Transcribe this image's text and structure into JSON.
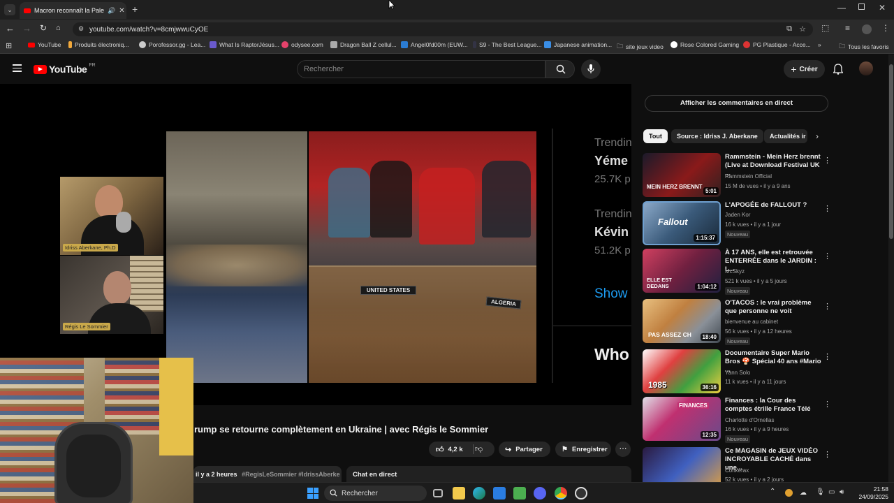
{
  "browser": {
    "tab_title": "Macron reconnaît la Palesti",
    "url": "youtube.com/watch?v=8cmjwwuCyOE",
    "bookmarks": [
      "YouTube",
      "Produits électroniq...",
      "Porofessor.gg - Lea...",
      "What Is RaptorJésus...",
      "odysee.com",
      "Dragon Ball Z cellul...",
      "Angel0fd00m (EUW...",
      "S9 - The Best League...",
      "Japanese animation...",
      "site jeux video",
      "Rose Colored Gaming",
      "PG Plastique - Acce..."
    ],
    "all_bookmarks": "Tous les favoris"
  },
  "youtube": {
    "logo": "YouTube",
    "country": "FR",
    "search_placeholder": "Rechercher",
    "create_label": "Créer"
  },
  "video": {
    "title": "rump se retourne complètement en Ukraine | avec Régis le Sommier",
    "likes": "4,2 k",
    "share_label": "Partager",
    "save_label": "Enregistrer",
    "date": "il y a 2 heures",
    "hashtags": "#RegisLeSommier #IdrissAberke",
    "live_chat_label": "Chat en direct",
    "guest1": "Idriss Aberkane, Ph.D",
    "guest2": "Régis Le Sommier",
    "placard_us": "UNITED STATES",
    "placard_algeria": "ALGERIA",
    "overlay": [
      {
        "label": "Trendin",
        "name": "Yéme",
        "count": "25.7K p"
      },
      {
        "label": "Trendin",
        "name": "Kévin",
        "count": "51.2K p"
      }
    ],
    "show_label": "Show",
    "who_label": "Who"
  },
  "sidebar": {
    "live_comments_btn": "Afficher les commentaires en direct",
    "chips": [
      "Tout",
      "Source : Idriss J. Aberkane",
      "Actualités ir"
    ],
    "videos": [
      {
        "title": "Rammstein - Mein Herz brennt (Live at Download Festival UK ...",
        "channel": "Rammstein Official",
        "meta": "15 M de vues • il y a 9 ans",
        "duration": "5:01",
        "thumb_text": "MEIN HERZ BRENNT",
        "new": ""
      },
      {
        "title": "L'APOGÉE de FALLOUT ?",
        "channel": "Jaden Kor",
        "meta": "16 k vues • il y a 1 jour",
        "duration": "1:15:37",
        "thumb_text": "Fallout",
        "new": "Nouveau"
      },
      {
        "title": "À 17 ANS, elle est retrouvée ENTERRÉE dans le JARDIN : L...",
        "channel": "McSkyz",
        "meta": "521 k vues • il y a 5 jours",
        "duration": "1:04:12",
        "thumb_text": "ELLE EST DEDANS",
        "new": "Nouveau"
      },
      {
        "title": "O'TACOS : le vrai problème que personne ne voit",
        "channel": "bienvenue au cabinet",
        "meta": "56 k vues • il y a 12 heures",
        "duration": "18:40",
        "thumb_text": "PAS ASSEZ CH",
        "new": "Nouveau"
      },
      {
        "title": "Documentaire Super Mario Bros 🍄 Spécial 40 ans #Mario ...",
        "channel": "Yann Solo",
        "meta": "11 k vues • il y a 11 jours",
        "duration": "36:16",
        "thumb_text": "1985",
        "new": ""
      },
      {
        "title": "Finances : la Cour des comptes étrille France Télé",
        "channel": "Charlotte d'Ornellas",
        "meta": "16 k vues • il y a 9 heures",
        "duration": "12:35",
        "thumb_text": "FINANCES",
        "new": "Nouveau"
      },
      {
        "title": "Ce MAGASIN de JEUX VIDÉO INCROYABLE CACHÉ dans une...",
        "channel": "Conkerax",
        "meta": "52 k vues • il y a 2 jours",
        "duration": "",
        "thumb_text": "",
        "new": ""
      }
    ]
  },
  "taskbar": {
    "search_label": "Rechercher",
    "time": "21:58",
    "date": "24/09/2025"
  },
  "colors": {
    "yt_red": "#ff0000",
    "bg": "#0f0f0f"
  }
}
